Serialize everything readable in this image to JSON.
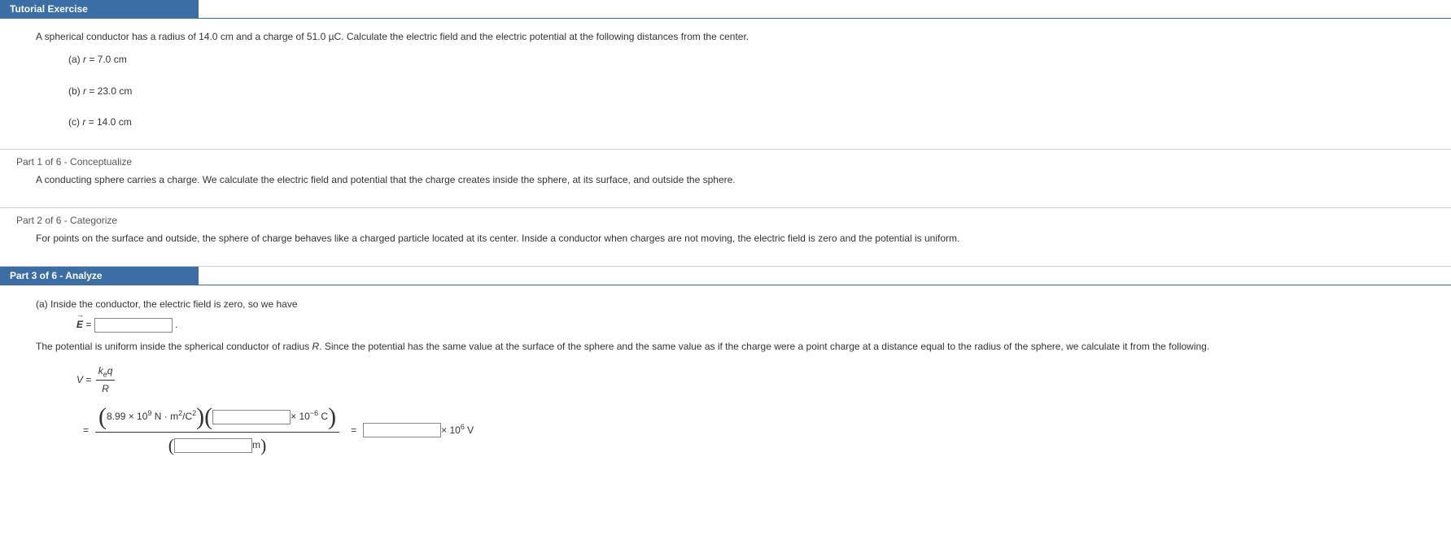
{
  "tutorial": {
    "tab": "Tutorial Exercise",
    "prompt_pre": "A spherical conductor has a radius of ",
    "radius": "14.0 cm",
    "prompt_mid": " and a charge of ",
    "charge": "51.0 µC",
    "prompt_post": ". Calculate the electric field and the electric potential at the following distances from the center.",
    "a_label": "(a) ",
    "a_var": "r",
    "a_eq": " = 7.0 cm",
    "b_label": "(b) ",
    "b_var": "r",
    "b_eq": " = 23.0 cm",
    "c_label": "(c) ",
    "c_var": "r",
    "c_eq": " = 14.0 cm"
  },
  "part1": {
    "title": "Part 1 of 6 - Conceptualize",
    "body": "A conducting sphere carries a charge. We calculate the electric field and potential that the charge creates inside the sphere, at its surface, and outside the sphere."
  },
  "part2": {
    "title": "Part 2 of 6 - Categorize",
    "body": "For points on the surface and outside, the sphere of charge behaves like a charged particle located at its center. Inside a conductor when charges are not moving, the electric field is zero and the potential is uniform."
  },
  "part3": {
    "tab": "Part 3 of 6 - Analyze",
    "line1": "(a) Inside the conductor, the electric field is zero, so we have",
    "E_sym": "E",
    "eq_sign": " = ",
    "period": " .",
    "line2_a": "The potential is uniform inside the spherical conductor of radius ",
    "R_sym": "R",
    "line2_b": ". Since the potential has the same value at the surface of the sphere and the same value as if the charge were a point charge at a distance equal to the radius of the sphere, we calculate it from the following.",
    "V_sym": "V",
    "frac_num_k": "k",
    "frac_num_e": "e",
    "frac_num_q": "q",
    "frac_den": "R",
    "const": "8.99 × 10",
    "const_exp": "9",
    "const_units_a": " N · m",
    "const_units_b": "/C",
    "times10_neg6": " × 10",
    "neg6": "−6",
    "C_unit": " C",
    "m_unit": " m",
    "times10_6": " × 10",
    "pos6": "6",
    "V_unit": " V"
  }
}
